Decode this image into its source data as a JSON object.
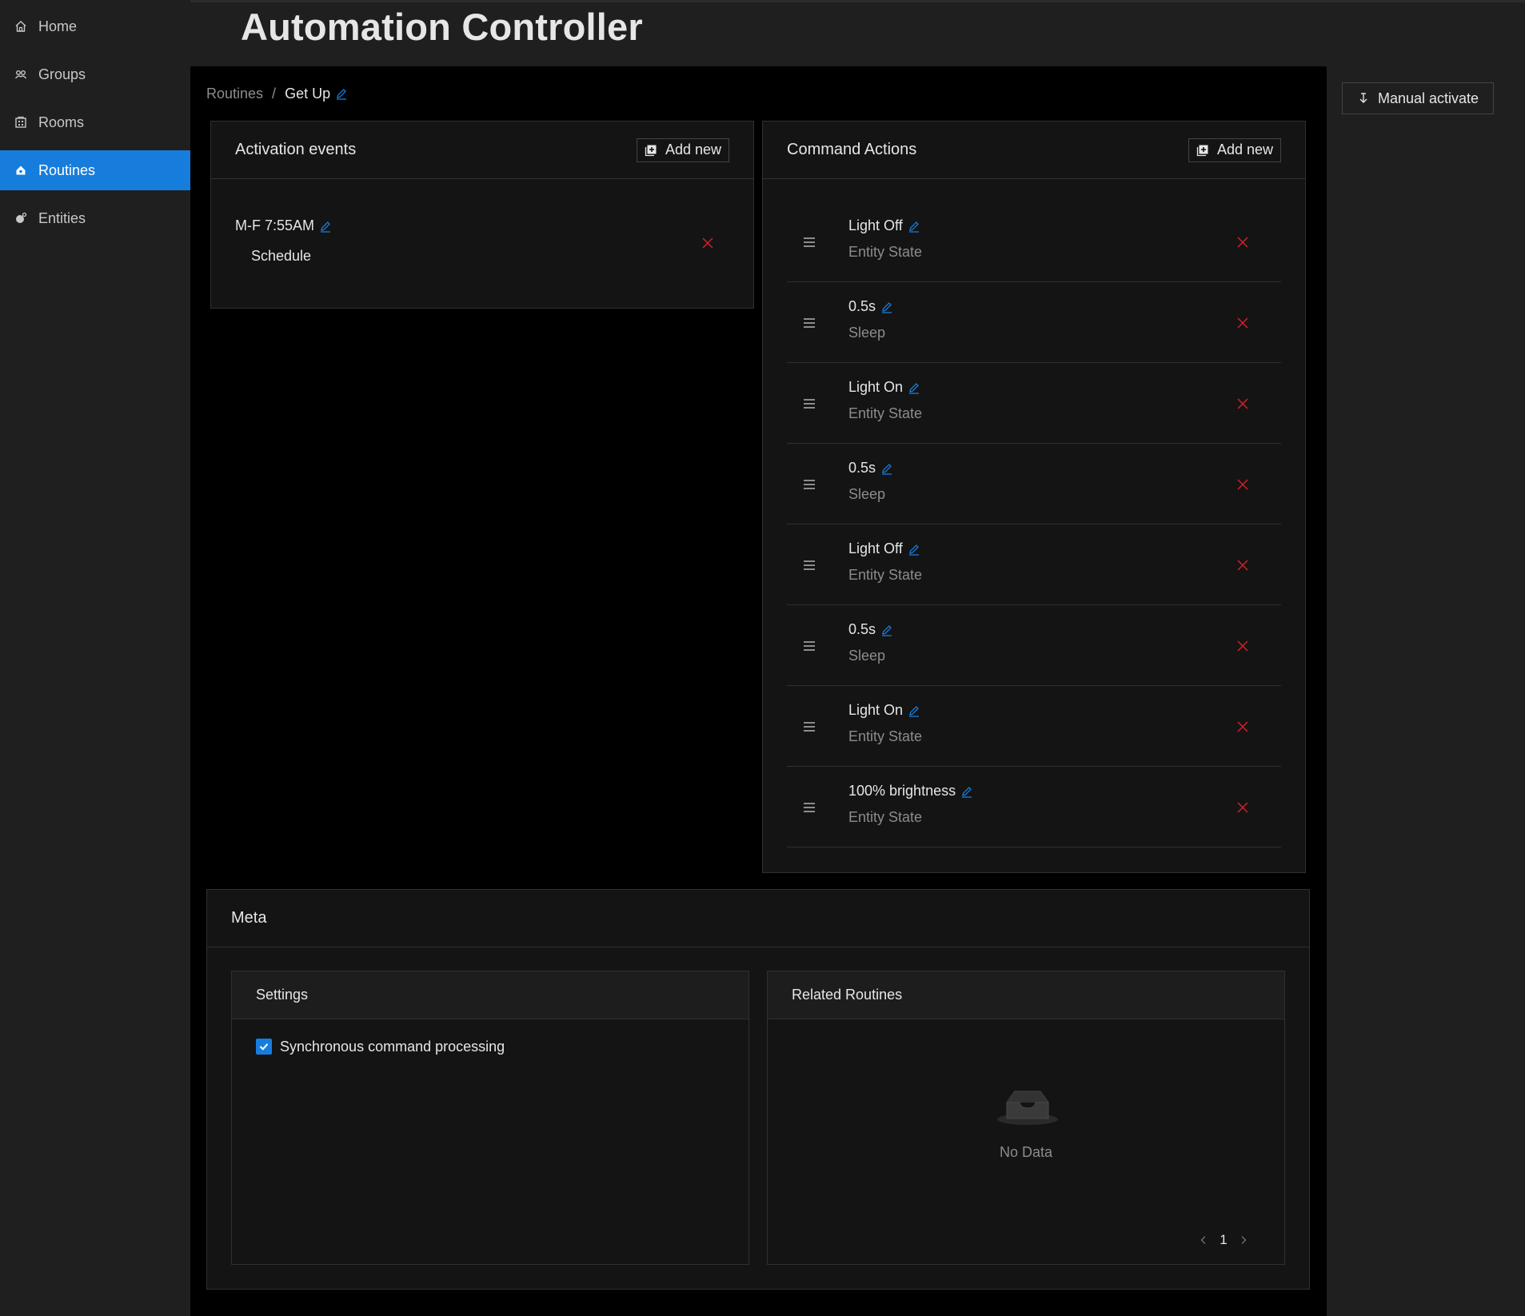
{
  "app": {
    "title": "Automation Controller"
  },
  "sidebar": {
    "items": [
      {
        "label": "Home",
        "icon": "home-icon"
      },
      {
        "label": "Groups",
        "icon": "groups-icon"
      },
      {
        "label": "Rooms",
        "icon": "rooms-icon"
      },
      {
        "label": "Routines",
        "icon": "routines-icon",
        "active": true
      },
      {
        "label": "Entities",
        "icon": "entities-icon"
      }
    ]
  },
  "breadcrumb": {
    "root": "Routines",
    "separator": "/",
    "current": "Get Up"
  },
  "manual_activate": {
    "label": "Manual activate"
  },
  "activation_events": {
    "title": "Activation events",
    "add_label": "Add new",
    "items": [
      {
        "name": "M-F 7:55AM",
        "type": "Schedule"
      }
    ]
  },
  "command_actions": {
    "title": "Command Actions",
    "add_label": "Add new",
    "items": [
      {
        "name": "Light Off",
        "type": "Entity State"
      },
      {
        "name": "0.5s",
        "type": "Sleep"
      },
      {
        "name": "Light On",
        "type": "Entity State"
      },
      {
        "name": "0.5s",
        "type": "Sleep"
      },
      {
        "name": "Light Off",
        "type": "Entity State"
      },
      {
        "name": "0.5s",
        "type": "Sleep"
      },
      {
        "name": "Light On",
        "type": "Entity State"
      },
      {
        "name": "100% brightness",
        "type": "Entity State"
      }
    ]
  },
  "meta": {
    "title": "Meta",
    "settings": {
      "title": "Settings",
      "sync_label": "Synchronous command processing",
      "sync_checked": true
    },
    "related": {
      "title": "Related Routines",
      "empty_text": "No Data",
      "page": "1"
    }
  },
  "colors": {
    "accent": "#177ddc",
    "danger": "#d32029",
    "background": "#000000",
    "panel": "#141414"
  }
}
